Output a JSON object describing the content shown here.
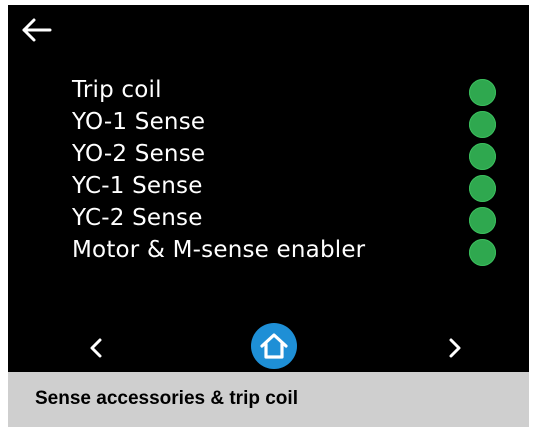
{
  "icons": {
    "back": "arrow-left-icon",
    "prev": "chevron-left-icon",
    "next": "chevron-right-icon",
    "home": "home-icon",
    "status": "status-dot-icon"
  },
  "colors": {
    "screen_background": "#000000",
    "text": "#ffffff",
    "status_ok": "#2fa84f",
    "home_button": "#1e8fd6",
    "caption_background": "#cfcfcf"
  },
  "accessories": [
    {
      "label": "Trip coil",
      "status": "ok"
    },
    {
      "label": "YO-1 Sense",
      "status": "ok"
    },
    {
      "label": "YO-2 Sense",
      "status": "ok"
    },
    {
      "label": "YC-1 Sense",
      "status": "ok"
    },
    {
      "label": "YC-2 Sense",
      "status": "ok"
    },
    {
      "label": "Motor & M-sense enabler",
      "status": "ok"
    }
  ],
  "caption": {
    "text": "Sense accessories & trip coil"
  }
}
